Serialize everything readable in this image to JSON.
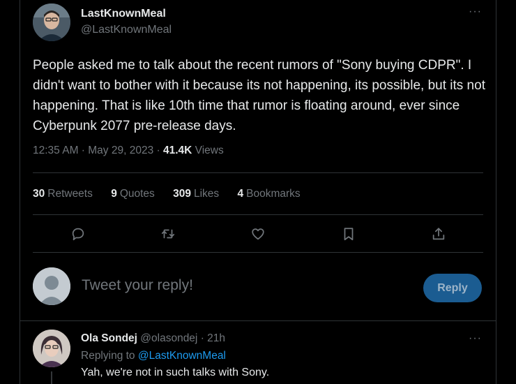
{
  "tweet": {
    "author": {
      "name": "LastKnownMeal",
      "handle": "@LastKnownMeal"
    },
    "more_icon": "···",
    "text": "People asked me to talk about the recent rumors of \"Sony buying CDPR\". I didn't want to bother with it because its not happening, its possible, but its not happening. That is like 10th time that rumor is floating around, ever since Cyberpunk 2077 pre-release days.",
    "timestamp": "12:35 AM · May 29, 2023 · ",
    "views_count": "41.4K",
    "views_label": " Views",
    "stats": {
      "retweets": {
        "count": "30",
        "label": "Retweets"
      },
      "quotes": {
        "count": "9",
        "label": "Quotes"
      },
      "likes": {
        "count": "309",
        "label": "Likes"
      },
      "bookmarks": {
        "count": "4",
        "label": "Bookmarks"
      }
    },
    "actions": [
      "reply-icon",
      "retweet-icon",
      "like-icon",
      "bookmark-icon",
      "share-icon"
    ]
  },
  "composer": {
    "placeholder": "Tweet your reply!",
    "button_label": "Reply"
  },
  "reply": {
    "name": "Ola Sondej",
    "handle": "@olasondej",
    "time": " · 21h",
    "more_icon": "···",
    "replying_prefix": "Replying to ",
    "replying_handle": "@LastKnownMeal",
    "text": "Yah, we're not in such talks with Sony."
  },
  "colors": {
    "background": "#000000",
    "text_primary": "#e7e9ea",
    "text_secondary": "#71767b",
    "accent": "#1d9bf0",
    "reply_button_bg": "#1b5c91",
    "divider": "#2f3336"
  }
}
